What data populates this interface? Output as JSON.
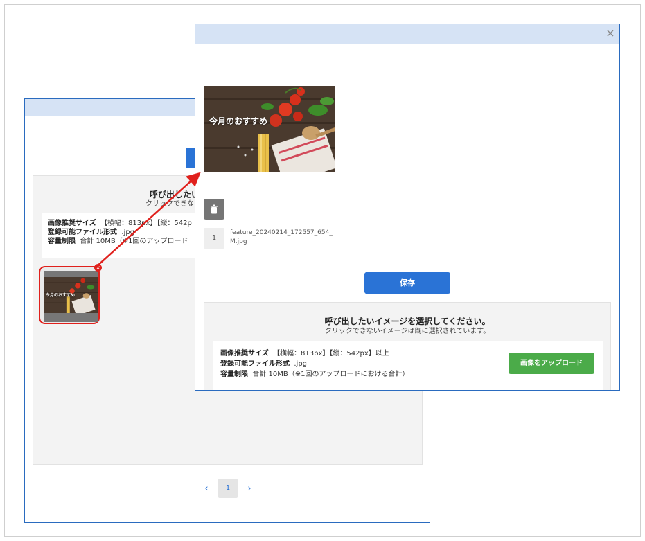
{
  "back_modal": {
    "panel_title": "呼び出したい",
    "panel_sub": "クリックできない",
    "info": {
      "size_label": "画像推奨サイズ",
      "size_value": "【横幅：813px】【縦：542p",
      "format_label": "登録可能ファイル形式",
      "format_value": ".jpg",
      "limit_label": "容量制限",
      "limit_value": "合計 10MB（※1回のアップロード"
    },
    "thumb_caption": "今月のおすすめ",
    "pagination": {
      "prev": "‹",
      "current": "1",
      "next": "›"
    }
  },
  "front_modal": {
    "close": "×",
    "photo_caption": "今月のおすすめ",
    "file_index": "1",
    "file_name": "feature_20240214_172557_654_M.jpg",
    "save_label": "保存",
    "panel_title": "呼び出したいイメージを選択してください。",
    "panel_sub": "クリックできないイメージは既に選択されています。",
    "info": {
      "size_label": "画像推奨サイズ",
      "size_value": "【横幅：813px】【縦：542px】以上",
      "format_label": "登録可能ファイル形式",
      "format_value": ".jpg",
      "limit_label": "容量制限",
      "limit_value": "合計 10MB（※1回のアップロードにおける合計）"
    },
    "upload_label": "画像をアップロード"
  },
  "colors": {
    "accent_blue": "#2a73d6",
    "upload_green": "#4bab49",
    "highlight_red": "#e0201c",
    "titlebar": "#d6e3f5"
  },
  "icons": [
    "close-icon",
    "trash-icon",
    "chevron-left-icon",
    "chevron-right-icon",
    "arrow-annotation"
  ]
}
